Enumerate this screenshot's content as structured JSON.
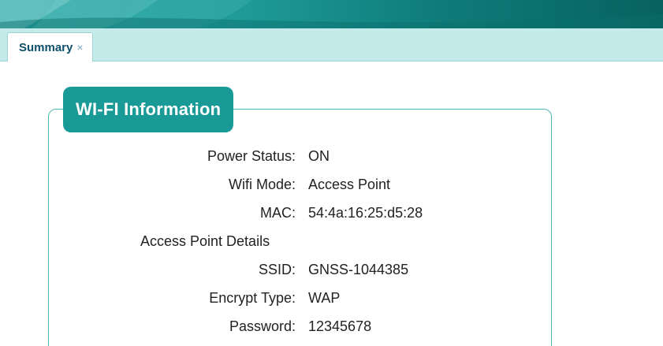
{
  "tabs": [
    {
      "label": "Summary",
      "close_glyph": "×"
    }
  ],
  "panel": {
    "title": "WI-FI Information"
  },
  "info": {
    "power_status": {
      "label": "Power Status:",
      "value": "ON"
    },
    "wifi_mode": {
      "label": "Wifi Mode:",
      "value": "Access Point"
    },
    "mac": {
      "label": "MAC:",
      "value": "54:4a:16:25:d5:28"
    },
    "ap_section": {
      "label": "Access Point Details"
    },
    "ssid": {
      "label": "SSID:",
      "value": "GNSS-1044385"
    },
    "encrypt_type": {
      "label": "Encrypt Type:",
      "value": "WAP"
    },
    "password": {
      "label": "Password:",
      "value": "12345678"
    }
  },
  "colors": {
    "accent": "#1a9a96",
    "tab_bar": "#c5eaea",
    "panel_border": "#55b7b3",
    "tab_text": "#0e4f6a"
  }
}
